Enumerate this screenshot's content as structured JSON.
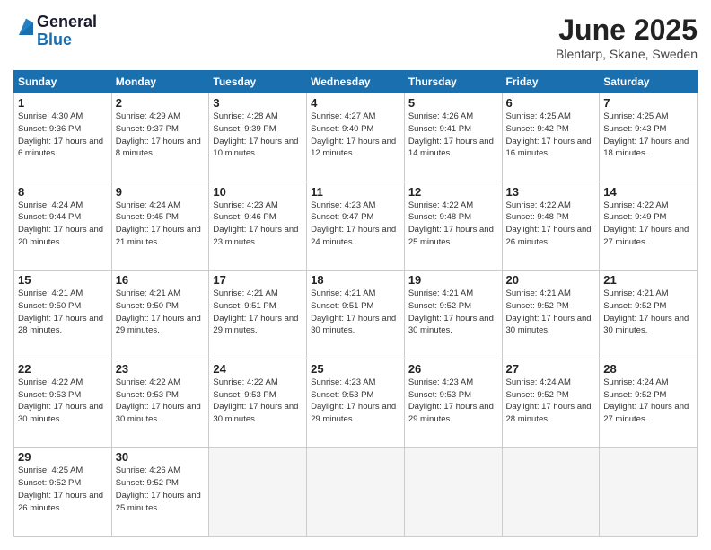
{
  "logo": {
    "general": "General",
    "blue": "Blue"
  },
  "title": "June 2025",
  "location": "Blentarp, Skane, Sweden",
  "headers": [
    "Sunday",
    "Monday",
    "Tuesday",
    "Wednesday",
    "Thursday",
    "Friday",
    "Saturday"
  ],
  "weeks": [
    [
      {
        "day": "1",
        "sunrise": "4:30 AM",
        "sunset": "9:36 PM",
        "daylight": "17 hours and 6 minutes."
      },
      {
        "day": "2",
        "sunrise": "4:29 AM",
        "sunset": "9:37 PM",
        "daylight": "17 hours and 8 minutes."
      },
      {
        "day": "3",
        "sunrise": "4:28 AM",
        "sunset": "9:39 PM",
        "daylight": "17 hours and 10 minutes."
      },
      {
        "day": "4",
        "sunrise": "4:27 AM",
        "sunset": "9:40 PM",
        "daylight": "17 hours and 12 minutes."
      },
      {
        "day": "5",
        "sunrise": "4:26 AM",
        "sunset": "9:41 PM",
        "daylight": "17 hours and 14 minutes."
      },
      {
        "day": "6",
        "sunrise": "4:25 AM",
        "sunset": "9:42 PM",
        "daylight": "17 hours and 16 minutes."
      },
      {
        "day": "7",
        "sunrise": "4:25 AM",
        "sunset": "9:43 PM",
        "daylight": "17 hours and 18 minutes."
      }
    ],
    [
      {
        "day": "8",
        "sunrise": "4:24 AM",
        "sunset": "9:44 PM",
        "daylight": "17 hours and 20 minutes."
      },
      {
        "day": "9",
        "sunrise": "4:24 AM",
        "sunset": "9:45 PM",
        "daylight": "17 hours and 21 minutes."
      },
      {
        "day": "10",
        "sunrise": "4:23 AM",
        "sunset": "9:46 PM",
        "daylight": "17 hours and 23 minutes."
      },
      {
        "day": "11",
        "sunrise": "4:23 AM",
        "sunset": "9:47 PM",
        "daylight": "17 hours and 24 minutes."
      },
      {
        "day": "12",
        "sunrise": "4:22 AM",
        "sunset": "9:48 PM",
        "daylight": "17 hours and 25 minutes."
      },
      {
        "day": "13",
        "sunrise": "4:22 AM",
        "sunset": "9:48 PM",
        "daylight": "17 hours and 26 minutes."
      },
      {
        "day": "14",
        "sunrise": "4:22 AM",
        "sunset": "9:49 PM",
        "daylight": "17 hours and 27 minutes."
      }
    ],
    [
      {
        "day": "15",
        "sunrise": "4:21 AM",
        "sunset": "9:50 PM",
        "daylight": "17 hours and 28 minutes."
      },
      {
        "day": "16",
        "sunrise": "4:21 AM",
        "sunset": "9:50 PM",
        "daylight": "17 hours and 29 minutes."
      },
      {
        "day": "17",
        "sunrise": "4:21 AM",
        "sunset": "9:51 PM",
        "daylight": "17 hours and 29 minutes."
      },
      {
        "day": "18",
        "sunrise": "4:21 AM",
        "sunset": "9:51 PM",
        "daylight": "17 hours and 30 minutes."
      },
      {
        "day": "19",
        "sunrise": "4:21 AM",
        "sunset": "9:52 PM",
        "daylight": "17 hours and 30 minutes."
      },
      {
        "day": "20",
        "sunrise": "4:21 AM",
        "sunset": "9:52 PM",
        "daylight": "17 hours and 30 minutes."
      },
      {
        "day": "21",
        "sunrise": "4:21 AM",
        "sunset": "9:52 PM",
        "daylight": "17 hours and 30 minutes."
      }
    ],
    [
      {
        "day": "22",
        "sunrise": "4:22 AM",
        "sunset": "9:53 PM",
        "daylight": "17 hours and 30 minutes."
      },
      {
        "day": "23",
        "sunrise": "4:22 AM",
        "sunset": "9:53 PM",
        "daylight": "17 hours and 30 minutes."
      },
      {
        "day": "24",
        "sunrise": "4:22 AM",
        "sunset": "9:53 PM",
        "daylight": "17 hours and 30 minutes."
      },
      {
        "day": "25",
        "sunrise": "4:23 AM",
        "sunset": "9:53 PM",
        "daylight": "17 hours and 29 minutes."
      },
      {
        "day": "26",
        "sunrise": "4:23 AM",
        "sunset": "9:53 PM",
        "daylight": "17 hours and 29 minutes."
      },
      {
        "day": "27",
        "sunrise": "4:24 AM",
        "sunset": "9:52 PM",
        "daylight": "17 hours and 28 minutes."
      },
      {
        "day": "28",
        "sunrise": "4:24 AM",
        "sunset": "9:52 PM",
        "daylight": "17 hours and 27 minutes."
      }
    ],
    [
      {
        "day": "29",
        "sunrise": "4:25 AM",
        "sunset": "9:52 PM",
        "daylight": "17 hours and 26 minutes."
      },
      {
        "day": "30",
        "sunrise": "4:26 AM",
        "sunset": "9:52 PM",
        "daylight": "17 hours and 25 minutes."
      },
      null,
      null,
      null,
      null,
      null
    ]
  ]
}
